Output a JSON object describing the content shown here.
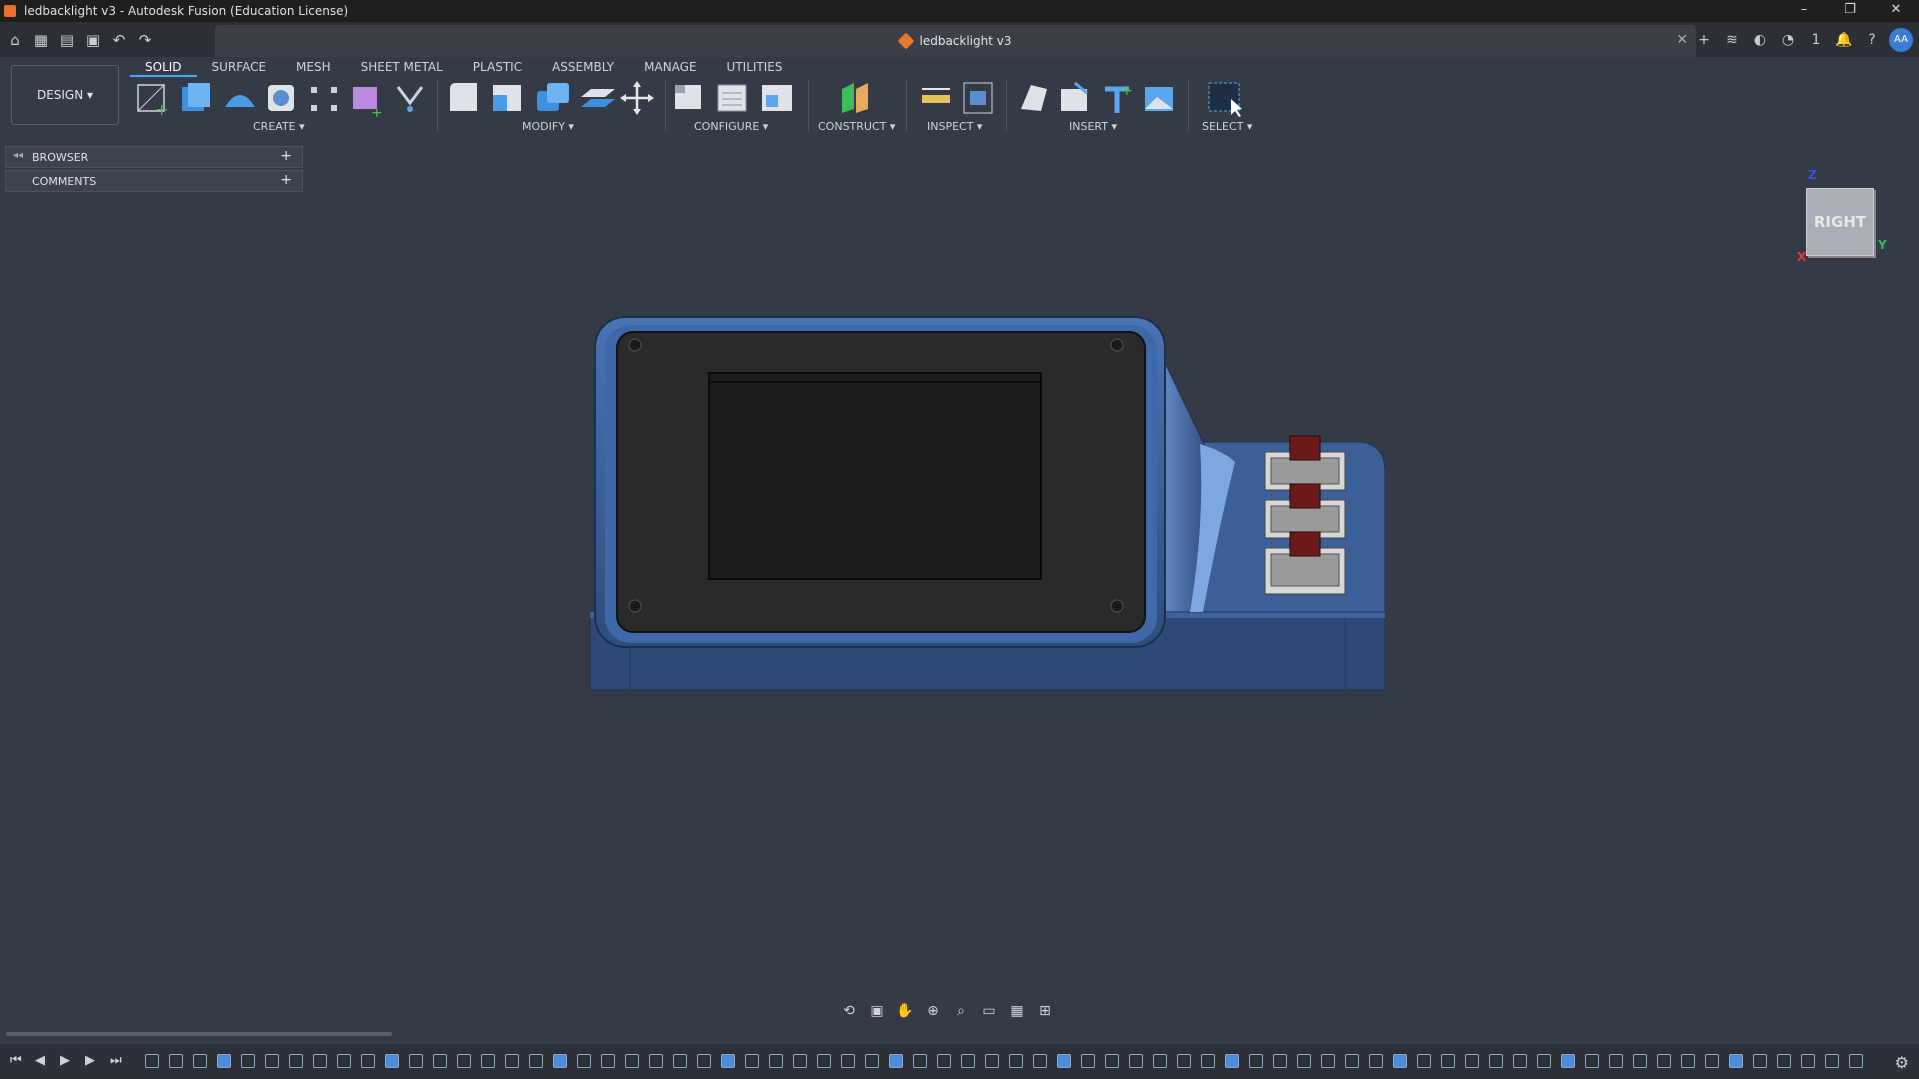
{
  "window": {
    "title": "ledbacklight v3 - Autodesk Fusion (Education License)",
    "controls": [
      "–",
      "❐",
      "✕"
    ]
  },
  "document": {
    "tab_label": "ledbacklight v3",
    "close": "✕"
  },
  "quick_access": {
    "icons": [
      "home-icon",
      "grid-icon",
      "file-icon",
      "save-icon",
      "undo-icon",
      "redo-icon"
    ],
    "right": {
      "notifications_count": "1",
      "avatar": "AA"
    }
  },
  "workspace": {
    "label": "DESIGN ▾"
  },
  "tabs": [
    "SOLID",
    "SURFACE",
    "MESH",
    "SHEET METAL",
    "PLASTIC",
    "ASSEMBLY",
    "MANAGE",
    "UTILITIES"
  ],
  "active_tab": "SOLID",
  "groups": [
    {
      "label": "CREATE ▾"
    },
    {
      "label": "MODIFY ▾"
    },
    {
      "label": "CONFIGURE ▾"
    },
    {
      "label": "CONSTRUCT ▾"
    },
    {
      "label": "INSPECT ▾"
    },
    {
      "label": "INSERT ▾"
    },
    {
      "label": "SELECT ▾"
    }
  ],
  "panels": {
    "browser": "BROWSER",
    "comments": "COMMENTS",
    "plus": "+",
    "collapse": "◂◂"
  },
  "viewcube": {
    "face": "RIGHT",
    "z": "Z",
    "y": "Y",
    "x": "X"
  },
  "colors": {
    "accent": "#4aa3ff",
    "body": "#3b5f96",
    "screen": "#2a2a2a"
  }
}
